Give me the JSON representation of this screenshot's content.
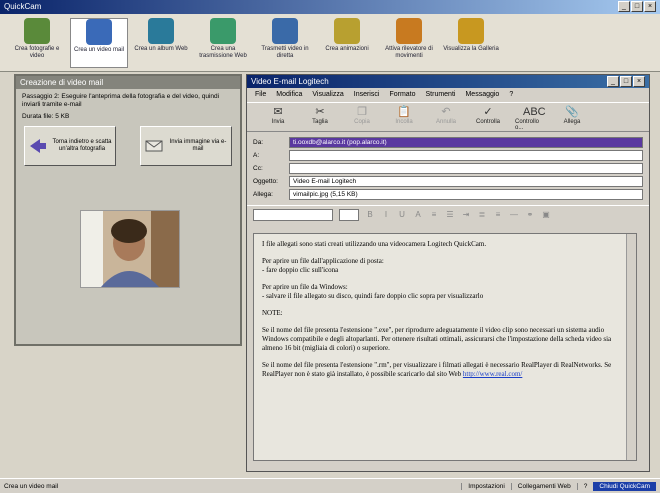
{
  "app": {
    "title": "QuickCam"
  },
  "toolbar": {
    "items": [
      {
        "label": "Crea fotografie e video",
        "color": "#5a8a3a"
      },
      {
        "label": "Crea un video mail",
        "color": "#3a6ab8"
      },
      {
        "label": "Crea un album Web",
        "color": "#2a7a9a"
      },
      {
        "label": "Crea una trasmissione Web",
        "color": "#3a9a6a"
      },
      {
        "label": "Trasmetti video in diretta",
        "color": "#3a6aa8"
      },
      {
        "label": "Crea animazioni",
        "color": "#b8a030"
      },
      {
        "label": "Attiva rilevatore di movimenti",
        "color": "#c87a20"
      },
      {
        "label": "Visualizza la Galleria",
        "color": "#c89820"
      }
    ]
  },
  "left_panel": {
    "title": "Creazione di video mail",
    "step": "Passaggio 2: Eseguire l'anteprima della fotografia e del video, quindi inviarli tramite e-mail",
    "duration": "Durata file: 5 KB",
    "back_label": "Torna indietro e scatta un'altra fotografia",
    "send_label": "Invia immagine via e-mail"
  },
  "mail": {
    "title": "Video E-mail Logitech",
    "menu": [
      "File",
      "Modifica",
      "Visualizza",
      "Inserisci",
      "Formato",
      "Strumenti",
      "Messaggio",
      "?"
    ],
    "tools": [
      {
        "label": "Invia",
        "icon": "✉",
        "disabled": false
      },
      {
        "label": "Taglia",
        "icon": "✂",
        "disabled": false
      },
      {
        "label": "Copia",
        "icon": "❐",
        "disabled": true
      },
      {
        "label": "Incolla",
        "icon": "📋",
        "disabled": true
      },
      {
        "label": "Annulla",
        "icon": "↶",
        "disabled": true
      },
      {
        "label": "Controlla",
        "icon": "✓",
        "disabled": false
      },
      {
        "label": "Controllo o...",
        "icon": "ABC",
        "disabled": false
      },
      {
        "label": "Allega",
        "icon": "📎",
        "disabled": false
      }
    ],
    "from_label": "Da:",
    "from_value": "ti.ooxdb@alarco.it (pop.alarco.it)",
    "to_label": "A:",
    "cc_label": "Cc:",
    "subject_label": "Oggetto:",
    "subject_value": "Video E-mail Logitech",
    "attach_label": "Allega:",
    "attach_value": "vimailpic.jpg (5,15 KB)",
    "body": {
      "p1": "I file allegati sono stati creati utilizzando una videocamera Logitech QuickCam.",
      "p2_line1": "Per aprire un file dall'applicazione di posta:",
      "p2_line2": "- fare doppio clic sull'icona",
      "p3_line1": "Per aprire un file da Windows:",
      "p3_line2": "- salvare il file allegato su disco, quindi fare doppio clic sopra per visualizzarlo",
      "p4": "NOTE:",
      "p5": "Se il nome del file presenta l'estensione \".exe\", per riprodurre adeguatamente il video clip sono necessari un sistema audio Windows compatibile e degli altoparlanti. Per ottenere risultati ottimali, assicurarsi che l'impostazione della scheda video sia almeno 16 bit (migliaia di colori) o superiore.",
      "p6": "Se il nome del file presenta l'estensione \".rm\", per visualizzare i filmati allegati è necessario RealPlayer di RealNetworks. Se RealPlayer non è stato già installato, è possibile scaricarlo dal sito Web",
      "link": "http://www.real.com/"
    }
  },
  "statusbar": {
    "text": "Crea un video mail",
    "item1": "Impostazioni",
    "item2": "Collegamenti Web",
    "item3": "?",
    "item4": "Chiudi QuickCam"
  }
}
